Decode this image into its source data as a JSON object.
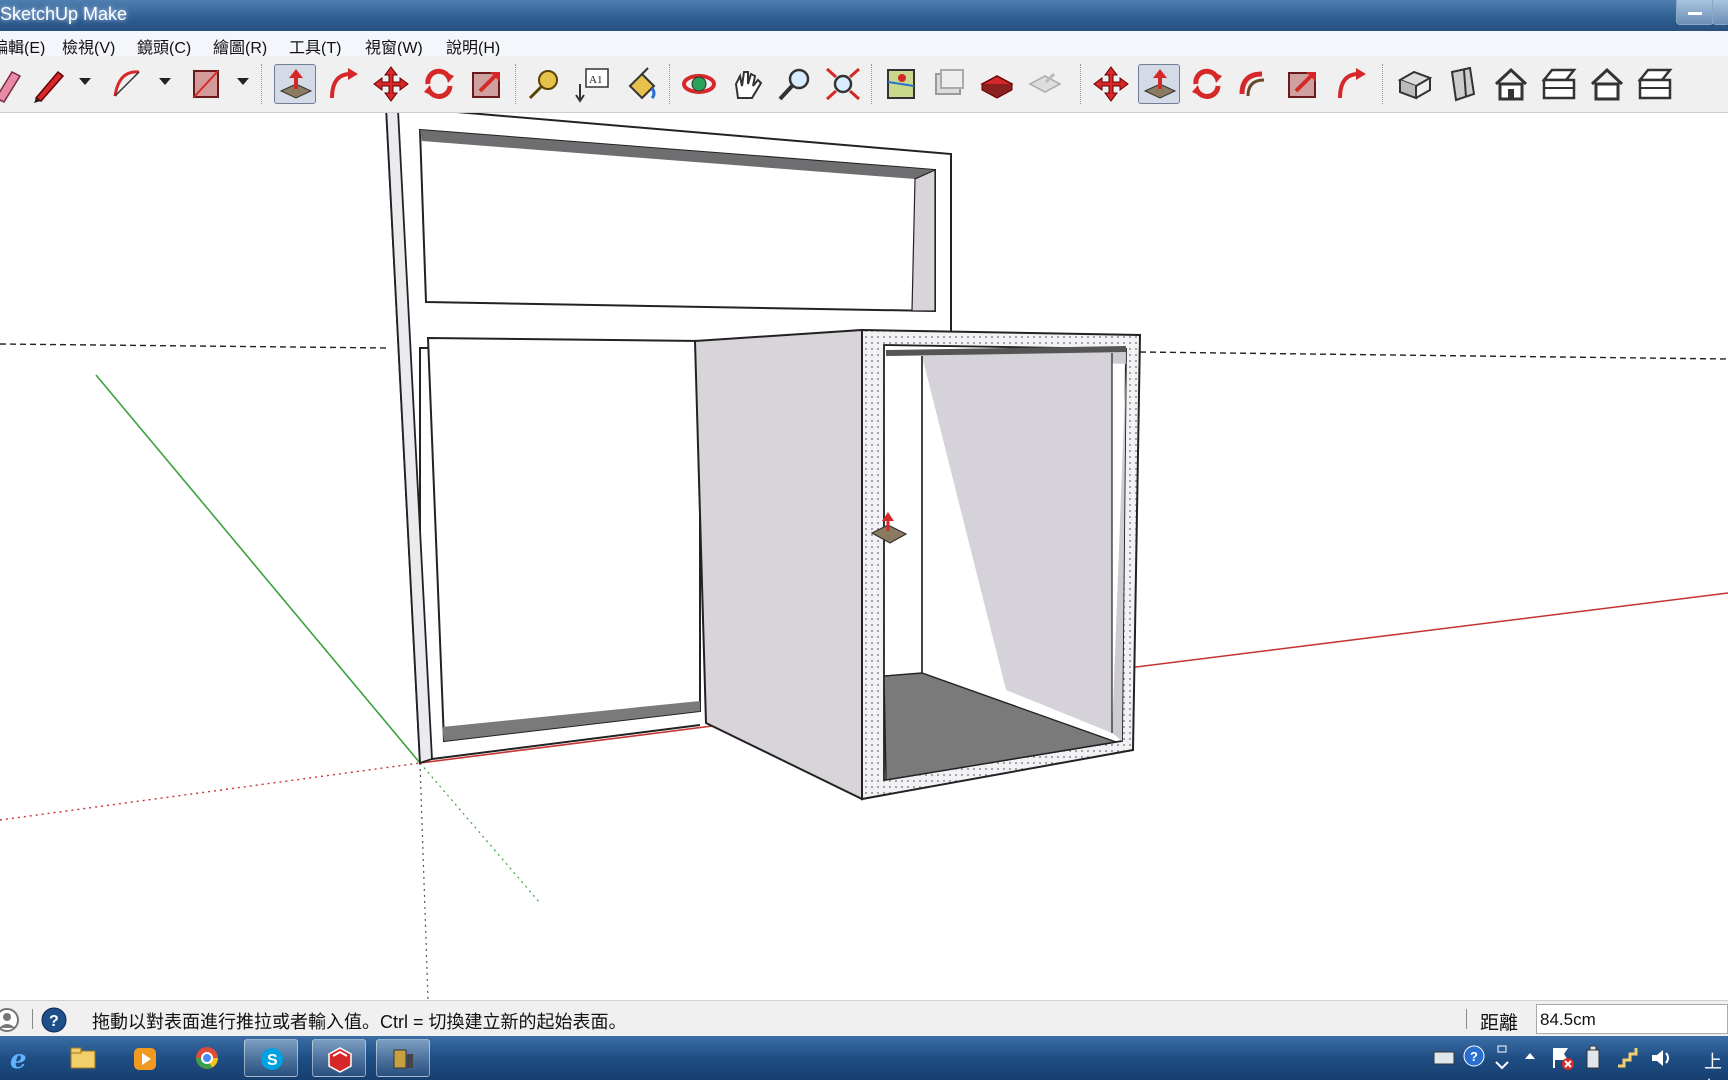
{
  "window": {
    "title": "SketchUp Make"
  },
  "menu": [
    "編輯(E)",
    "檢視(V)",
    "鏡頭(C)",
    "繪圖(R)",
    "工具(T)",
    "視窗(W)",
    "說明(H)"
  ],
  "toolbar": {
    "active_tool": "push-pull",
    "tools": [
      "eraser",
      "pencil",
      "line-dropdown",
      "arc",
      "arc-dropdown",
      "rectangle",
      "shape-dropdown",
      "push-pull",
      "follow-me",
      "move",
      "rotate",
      "scale",
      "tape-measure",
      "text",
      "paint-bucket",
      "orbit",
      "pan",
      "zoom",
      "zoom-extents",
      "add-location",
      "photo-textures",
      "get-models",
      "share-model",
      "move",
      "push-pull",
      "rotate",
      "offset",
      "scale",
      "follow-me",
      "iso-view",
      "top-view",
      "front-view",
      "right-view",
      "back-view",
      "left-view"
    ]
  },
  "colors": {
    "accent_red": "#d62828",
    "axis_green": "#3aa33a",
    "axis_red": "#c83232",
    "face": "#d8d4da",
    "face_dark": "#7a7a7a"
  },
  "status": {
    "message": "拖動以對表面進行推拉或者輸入值。Ctrl = 切換建立新的起始表面。",
    "vcb_label": "距離",
    "vcb_value": "84.5cm"
  },
  "taskbar": {
    "apps": [
      "internet-explorer",
      "file-explorer",
      "media-player",
      "chrome",
      "skype",
      "sketchup",
      "tool-app"
    ],
    "clock": "上午"
  }
}
